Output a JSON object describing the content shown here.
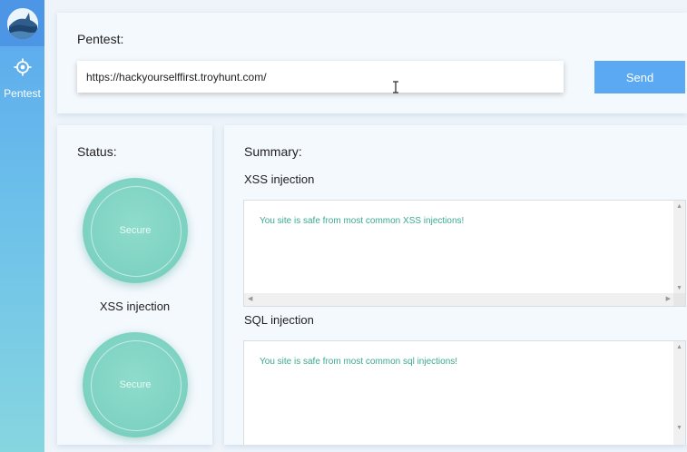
{
  "sidebar": {
    "nav_items": [
      {
        "label": "Pentest",
        "icon": "crosshair-icon"
      }
    ]
  },
  "pentest": {
    "title": "Pentest:",
    "url_value": "https://hackyourselffirst.troyhunt.com/",
    "send_label": "Send"
  },
  "status": {
    "title": "Status:",
    "items": [
      {
        "badge": "Secure",
        "label": "XSS injection"
      },
      {
        "badge": "Secure",
        "label": ""
      }
    ]
  },
  "summary": {
    "title": "Summary:",
    "sections": [
      {
        "label": "XSS injection",
        "result": "You site is safe from most common XSS injections!"
      },
      {
        "label": "SQL injection",
        "result": "You site is safe from most common sql injections!"
      }
    ]
  },
  "colors": {
    "accent": "#5aa9f2",
    "secure": "#7fd3c2",
    "result_text": "#3aaa8e"
  }
}
